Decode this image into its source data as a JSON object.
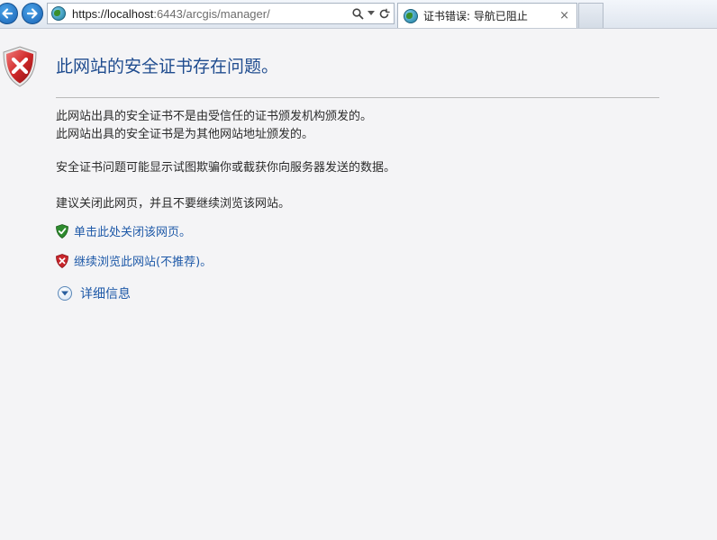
{
  "browser": {
    "address": {
      "url_prefix": "https://",
      "url_host": "localhost",
      "url_rest": ":6443/arcgis/manager/",
      "search_icon": "search-icon",
      "dropdown_icon": "chevron-down-icon",
      "refresh_icon": "refresh-icon"
    },
    "tab": {
      "title": "证书错误: 导航已阻止",
      "close": "×"
    }
  },
  "page": {
    "title": "此网站的安全证书存在问题。",
    "paragraphs": [
      "此网站出具的安全证书不是由受信任的证书颁发机构颁发的。",
      "此网站出具的安全证书是为其他网站地址颁发的。",
      "安全证书问题可能显示试图欺骗你或截获你向服务器发送的数据。",
      "建议关闭此网页，并且不要继续浏览该网站。"
    ],
    "links": {
      "close_page": "单击此处关闭该网页。",
      "continue_site": "继续浏览此网站(不推荐)。"
    },
    "details": "详细信息"
  },
  "colors": {
    "title": "#1f4c8f",
    "link": "#1e59a8",
    "shield_red": "#c8252b",
    "shield_green": "#2e8b2e"
  }
}
